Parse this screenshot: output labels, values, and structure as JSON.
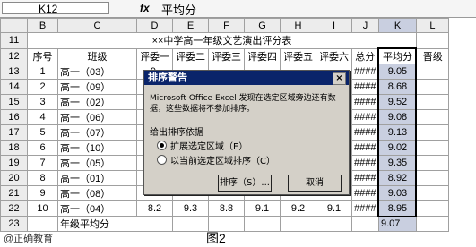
{
  "formula_bar": {
    "cell_ref": "K12",
    "fx": "fx",
    "content": "平均分"
  },
  "columns": [
    "B",
    "C",
    "D",
    "E",
    "F",
    "G",
    "H",
    "I",
    "J",
    "K",
    "L"
  ],
  "row11": {
    "num": "11",
    "title": "××中学高一年级文艺演出评分表"
  },
  "headers": [
    "序号",
    "班级",
    "评委一",
    "评委二",
    "评委三",
    "评委四",
    "评委五",
    "评委六",
    "总分",
    "平均分",
    "晋级"
  ],
  "rows": [
    {
      "num": "13",
      "cells": [
        "1",
        "高一（03）",
        "9.",
        "",
        "",
        "",
        "",
        "",
        "####",
        "9.05",
        ""
      ]
    },
    {
      "num": "14",
      "cells": [
        "2",
        "高一（09）",
        "8.",
        "",
        "",
        "",
        "",
        "",
        "####",
        "8.68",
        ""
      ]
    },
    {
      "num": "15",
      "cells": [
        "3",
        "高一（02）",
        "9.",
        "",
        "",
        "",
        "",
        "",
        "####",
        "9.52",
        ""
      ]
    },
    {
      "num": "16",
      "cells": [
        "4",
        "高一（06）",
        "9.",
        "",
        "",
        "",
        "",
        "",
        "####",
        "9.08",
        ""
      ]
    },
    {
      "num": "17",
      "cells": [
        "5",
        "高一（07）",
        "9.",
        "",
        "",
        "",
        "",
        "",
        "####",
        "9.13",
        ""
      ]
    },
    {
      "num": "18",
      "cells": [
        "6",
        "高一（10）",
        "8.",
        "",
        "",
        "",
        "",
        "",
        "####",
        "9.02",
        ""
      ]
    },
    {
      "num": "19",
      "cells": [
        "7",
        "高一（05）",
        "9.",
        "",
        "",
        "",
        "",
        "",
        "####",
        "9.35",
        ""
      ]
    },
    {
      "num": "20",
      "cells": [
        "8",
        "高一（01）",
        "8.",
        "",
        "",
        "",
        "",
        "",
        "####",
        "8.92",
        ""
      ]
    },
    {
      "num": "21",
      "cells": [
        "9",
        "高一（08）",
        "9.",
        "",
        "",
        "",
        "",
        "",
        "####",
        "9.03",
        ""
      ]
    },
    {
      "num": "22",
      "cells": [
        "10",
        "高一（04）",
        "8.2",
        "9.3",
        "8.8",
        "9.1",
        "9.2",
        "9.1",
        "####",
        "8.95",
        ""
      ]
    }
  ],
  "row23": {
    "num": "23",
    "label": "年级平均分",
    "avg": "9.07"
  },
  "dialog": {
    "title": "排序警告",
    "close": "×",
    "message": "Microsoft Office Excel 发现在选定区域旁边还有数据，这些数据将不参加排序。",
    "group_label": "给出排序依据",
    "option1": "扩展选定区域（E）",
    "option2": "以当前选定区域排序（C）",
    "sort_button": "排序（S）...",
    "cancel_button": "取消"
  },
  "footer": {
    "watermark": "@正确教育",
    "caption": "图2"
  }
}
